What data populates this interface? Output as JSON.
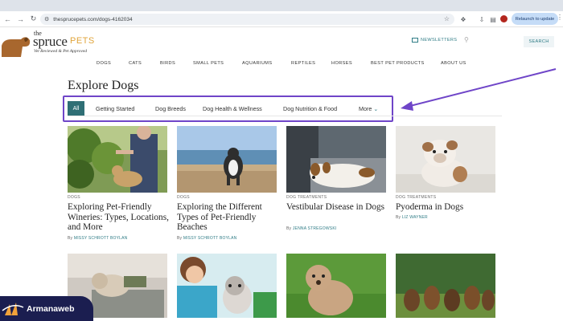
{
  "browser": {
    "url": "thespruce​pets.com/dogs-4162034",
    "relaunch_label": "Relaunch to update"
  },
  "site": {
    "logo": {
      "the": "the",
      "spruce": "spruce",
      "pets": "PETS",
      "tagline": "Vet Reviewed & Pet Approved"
    },
    "newsletters_label": "NEWSLETTERS",
    "search_label": "SEARCH",
    "nav": [
      "DOGS",
      "CATS",
      "BIRDS",
      "SMALL PETS",
      "AQUARIUMS",
      "REPTILES",
      "HORSES",
      "BEST PET PRODUCTS",
      "ABOUT US"
    ]
  },
  "explore": {
    "title": "Explore Dogs",
    "filters": [
      "All",
      "Getting Started",
      "Dog Breeds",
      "Dog Health & Wellness",
      "Dog Nutrition & Food",
      "More"
    ],
    "active_filter": "All"
  },
  "cards": [
    {
      "tag": "DOGS",
      "title": "Exploring Pet-Friendly Wineries: Types, Locations, and More",
      "by": "By",
      "author": "MISSY SCHROTT BOYLAN"
    },
    {
      "tag": "DOGS",
      "title": "Exploring the Different Types of Pet-Friendly Beaches",
      "by": "By",
      "author": "MISSY SCHROTT BOYLAN"
    },
    {
      "tag": "DOG TREATMENTS",
      "title": "Vestibular Disease in Dogs",
      "by": "By",
      "author": "JENNA STREGOWSKI"
    },
    {
      "tag": "DOG TREATMENTS",
      "title": "Pyoderma in Dogs",
      "by": "By",
      "author": "LIZ WAYNER"
    }
  ],
  "watermark": "Armanaweb",
  "colors": {
    "accent_teal": "#2f6f75",
    "annotation_purple": "#6f45c8",
    "logo_orange": "#e0a43a"
  }
}
